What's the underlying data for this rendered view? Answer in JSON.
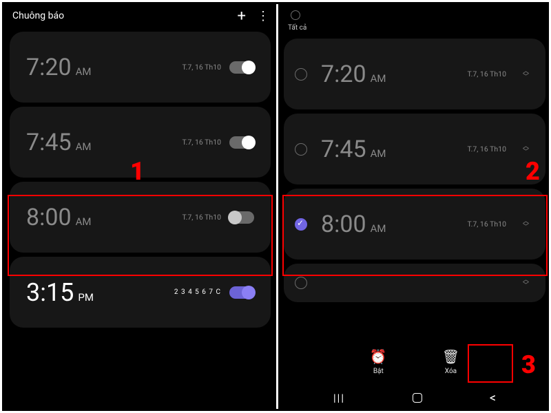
{
  "left": {
    "title": "Chuông báo",
    "alarms": [
      {
        "time": "7:20",
        "ampm": "AM",
        "sched": "T.7, 16 Th10",
        "on": true,
        "bright": false
      },
      {
        "time": "7:45",
        "ampm": "AM",
        "sched": "T.7, 16 Th10",
        "on": true,
        "bright": false
      },
      {
        "time": "8:00",
        "ampm": "AM",
        "sched": "T.7, 16 Th10",
        "on": false,
        "bright": false
      },
      {
        "time": "3:15",
        "ampm": "PM",
        "sched": "2 3 4 5 6 7 C",
        "on": true,
        "bright": true,
        "purple": true
      }
    ]
  },
  "right": {
    "selectAll": "Tất cả",
    "alarms": [
      {
        "time": "7:20",
        "ampm": "AM",
        "sched": "T.7, 16 Th10",
        "sel": false
      },
      {
        "time": "7:45",
        "ampm": "AM",
        "sched": "T.7, 16 Th10",
        "sel": false
      },
      {
        "time": "8:00",
        "ampm": "AM",
        "sched": "T.7, 16 Th10",
        "sel": true
      }
    ],
    "actions": {
      "on": "Bật",
      "del": "Xóa"
    }
  },
  "ann": {
    "1": "1",
    "2": "2",
    "3": "3"
  }
}
